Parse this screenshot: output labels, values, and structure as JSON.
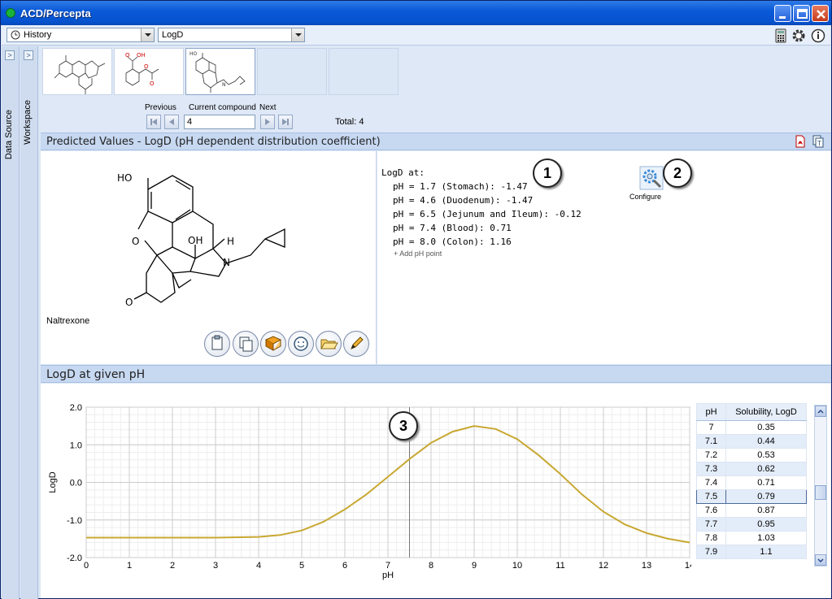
{
  "window": {
    "title": "ACD/Percepta"
  },
  "toolbar": {
    "history_value": "History",
    "property_value": "LogD"
  },
  "sidebar": {
    "data_source": "Data Source",
    "workspace": "Workspace"
  },
  "navigator": {
    "previous_label": "Previous",
    "current_label": "Current compound",
    "next_label": "Next",
    "current_value": "4",
    "total_label": "Total: 4"
  },
  "predicted": {
    "header": "Predicted Values - LogD (pH dependent distribution coefficient)",
    "compound_name": "Naltrexone",
    "logd_heading": "LogD at:",
    "values": [
      "pH = 1.7 (Stomach): -1.47",
      "pH = 4.6 (Duodenum): -1.47",
      "pH = 6.5 (Jejunum and Ileum): -0.12",
      "pH = 7.4 (Blood): 0.71",
      "pH = 8.0 (Colon): 1.16"
    ],
    "add_ph_label": "+ Add pH point",
    "configure_label": "Configure",
    "callout_1": "1",
    "callout_2": "2"
  },
  "chart_section": {
    "header": "LogD at given pH",
    "callout_3": "3"
  },
  "chart_data": {
    "type": "line",
    "xlabel": "pH",
    "ylabel": "LogD",
    "xlim": [
      0,
      14
    ],
    "ylim": [
      -2.0,
      2.0
    ],
    "x_ticks": [
      "0",
      "1",
      "2",
      "3",
      "4",
      "5",
      "6",
      "7",
      "8",
      "9",
      "10",
      "11",
      "12",
      "13",
      "14"
    ],
    "y_ticks": [
      "2.0",
      "1.0",
      "0.0",
      "-1.0",
      "-2.0"
    ],
    "grid": true,
    "cursor_x": 7.5,
    "line_color": "#c8a832",
    "x": [
      0,
      1,
      2,
      3,
      4,
      4.5,
      5,
      5.5,
      6,
      6.5,
      7,
      7.5,
      8,
      8.5,
      9,
      9.5,
      10,
      10.5,
      11,
      11.5,
      12,
      12.5,
      13,
      13.5,
      14
    ],
    "y": [
      -1.47,
      -1.47,
      -1.47,
      -1.47,
      -1.45,
      -1.4,
      -1.28,
      -1.05,
      -0.72,
      -0.32,
      0.15,
      0.62,
      1.05,
      1.35,
      1.5,
      1.42,
      1.15,
      0.72,
      0.22,
      -0.32,
      -0.78,
      -1.12,
      -1.35,
      -1.5,
      -1.6
    ]
  },
  "table": {
    "col_ph": "pH",
    "col_value": "Solubility, LogD",
    "rows": [
      {
        "ph": "7",
        "v": "0.35"
      },
      {
        "ph": "7.1",
        "v": "0.44"
      },
      {
        "ph": "7.2",
        "v": "0.53"
      },
      {
        "ph": "7.3",
        "v": "0.62"
      },
      {
        "ph": "7.4",
        "v": "0.71"
      },
      {
        "ph": "7.5",
        "v": "0.79"
      },
      {
        "ph": "7.6",
        "v": "0.87"
      },
      {
        "ph": "7.7",
        "v": "0.95"
      },
      {
        "ph": "7.8",
        "v": "1.03"
      },
      {
        "ph": "7.9",
        "v": "1.1"
      }
    ],
    "selected_index": 5
  }
}
